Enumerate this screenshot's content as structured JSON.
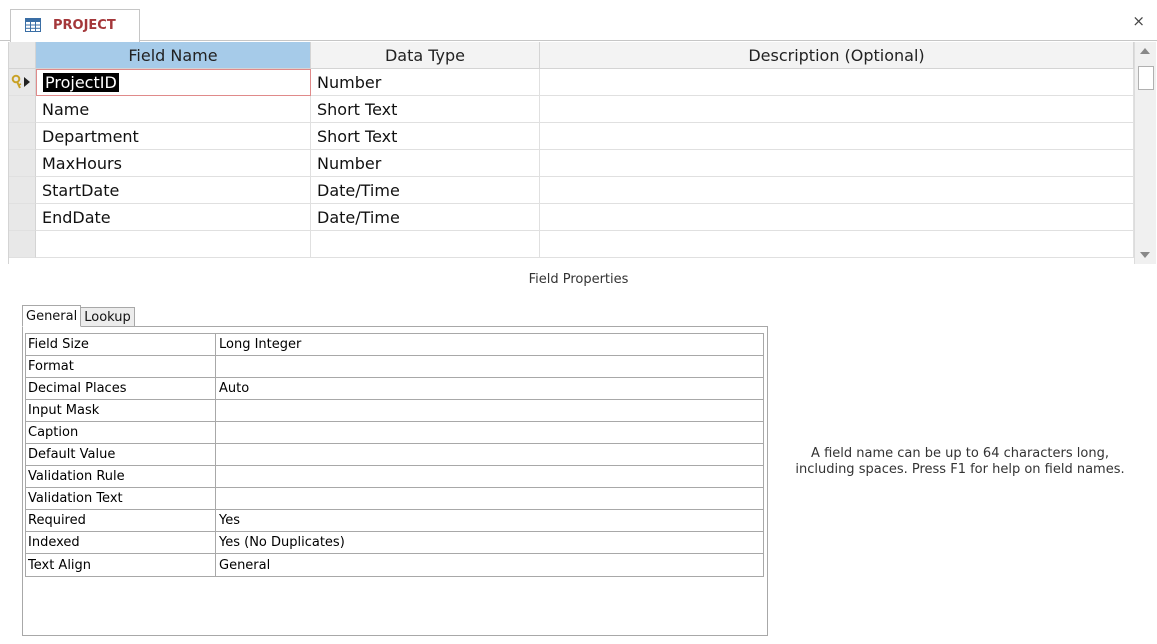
{
  "document_tab": {
    "title": "PROJECT",
    "close_glyph": "×",
    "icon": "table-icon"
  },
  "grid": {
    "headers": {
      "field_name": "Field Name",
      "data_type": "Data Type",
      "description": "Description (Optional)"
    },
    "rows": [
      {
        "field_name": "ProjectID",
        "data_type": "Number",
        "description": "",
        "primary_key": true,
        "active": true
      },
      {
        "field_name": "Name",
        "data_type": "Short Text",
        "description": ""
      },
      {
        "field_name": "Department",
        "data_type": "Short Text",
        "description": ""
      },
      {
        "field_name": "MaxHours",
        "data_type": "Number",
        "description": ""
      },
      {
        "field_name": "StartDate",
        "data_type": "Date/Time",
        "description": ""
      },
      {
        "field_name": "EndDate",
        "data_type": "Date/Time",
        "description": ""
      },
      {
        "field_name": "",
        "data_type": "",
        "description": ""
      }
    ]
  },
  "field_properties": {
    "title": "Field Properties",
    "tabs": [
      "General",
      "Lookup"
    ],
    "properties": [
      {
        "label": "Field Size",
        "value": "Long Integer"
      },
      {
        "label": "Format",
        "value": ""
      },
      {
        "label": "Decimal Places",
        "value": "Auto"
      },
      {
        "label": "Input Mask",
        "value": ""
      },
      {
        "label": "Caption",
        "value": ""
      },
      {
        "label": "Default Value",
        "value": ""
      },
      {
        "label": "Validation Rule",
        "value": ""
      },
      {
        "label": "Validation Text",
        "value": ""
      },
      {
        "label": "Required",
        "value": "Yes"
      },
      {
        "label": "Indexed",
        "value": "Yes (No Duplicates)"
      },
      {
        "label": "Text Align",
        "value": "General"
      }
    ],
    "help_text": "A field name can be up to 64 characters long, including spaces. Press F1 for help on field names."
  },
  "colors": {
    "tab_title": "#a4373a",
    "field_name_header": "#a6cbe9",
    "active_border": "#e08a8a"
  }
}
